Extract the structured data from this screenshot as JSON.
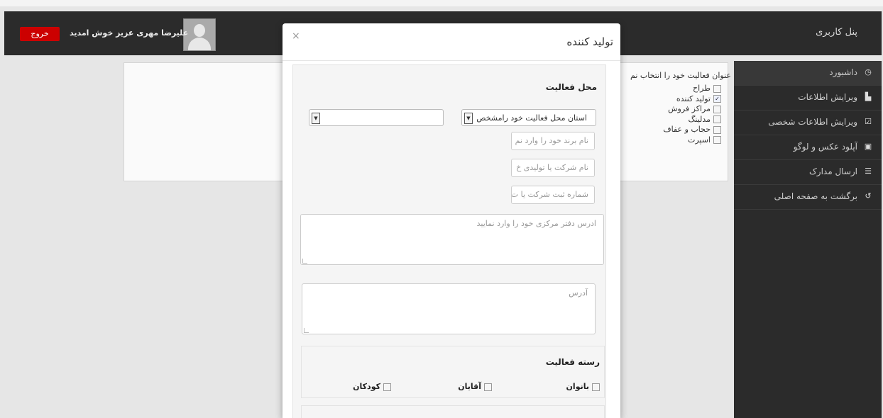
{
  "header": {
    "panel_title": "پنل کاربری",
    "welcome_text": "علیرضا مهری عزیز خوش امدید",
    "logout_label": "خروج"
  },
  "sidebar": {
    "items": [
      {
        "label": "داشبورد",
        "icon": "dashboard-icon"
      },
      {
        "label": "ویرایش اطلاعات",
        "icon": "file-icon"
      },
      {
        "label": "ویرایش اطلاعات شخصی",
        "icon": "edit-icon"
      },
      {
        "label": "آپلود عکس و لوگو",
        "icon": "image-icon"
      },
      {
        "label": "ارسال مدارک",
        "icon": "list-icon"
      },
      {
        "label": "برگشت به صفحه اصلی",
        "icon": "return-icon"
      }
    ]
  },
  "main": {
    "category_title": "عنوان فعالیت خود را انتخاب نم",
    "categories": [
      {
        "label": "طراح",
        "checked": false
      },
      {
        "label": "تولید کننده",
        "checked": true
      },
      {
        "label": "مراکز فروش",
        "checked": false
      },
      {
        "label": "مدلینگ",
        "checked": false
      },
      {
        "label": "حجاب و عفاف",
        "checked": false
      },
      {
        "label": "اسپرت",
        "checked": false
      }
    ]
  },
  "modal": {
    "title": "تولید کننده",
    "close": "×",
    "location_title": "محل فعالیت",
    "province_value": "استان محل فعالیت خود رامشخص",
    "city_value": "",
    "brand_placeholder": "نام برند خود را وارد نم",
    "company_placeholder": "نام شرکت یا تولیدی خ",
    "reg_placeholder": "شماره ثبت شرکت یا ت",
    "office_address_placeholder": "ادرس دفتر مرکزی خود را وارد نمایید",
    "address_placeholder": "آدرس",
    "activity_title": "رسته فعالیت",
    "genders": [
      {
        "label": "بانوان",
        "checked": false
      },
      {
        "label": "آقایان",
        "checked": false
      },
      {
        "label": "کودکان",
        "checked": false
      }
    ]
  }
}
